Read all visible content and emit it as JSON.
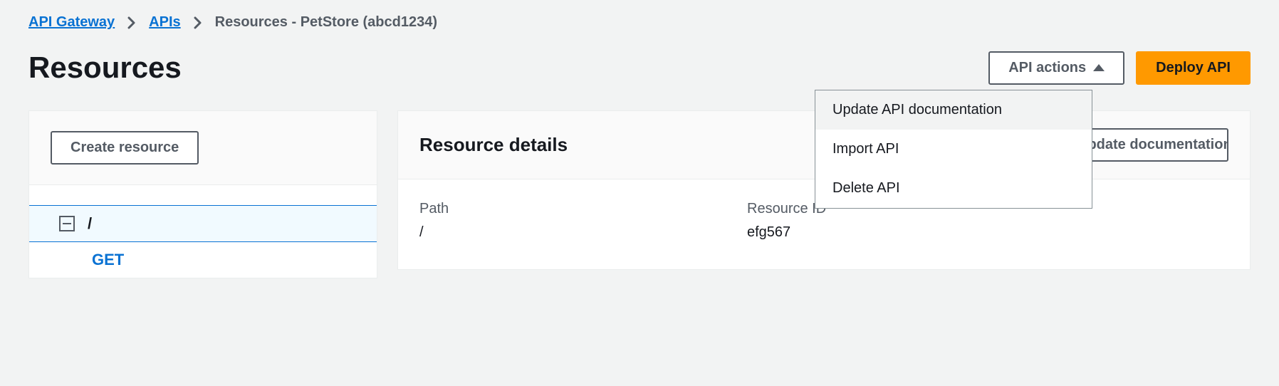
{
  "breadcrumb": {
    "items": [
      "API Gateway",
      "APIs"
    ],
    "current": "Resources - PetStore (abcd1234)"
  },
  "page_title": "Resources",
  "header": {
    "api_actions_label": "API actions",
    "deploy_label": "Deploy API",
    "dropdown": {
      "items": [
        "Update API documentation",
        "Import API",
        "Delete API"
      ]
    }
  },
  "left_panel": {
    "create_resource_label": "Create resource",
    "tree": {
      "root_label": "/",
      "children": [
        "GET"
      ]
    }
  },
  "right_panel": {
    "title": "Resource details",
    "update_doc_label": "Update documentation",
    "fields": {
      "path_label": "Path",
      "path_value": "/",
      "resource_id_label": "Resource ID",
      "resource_id_value": "efg567"
    }
  }
}
